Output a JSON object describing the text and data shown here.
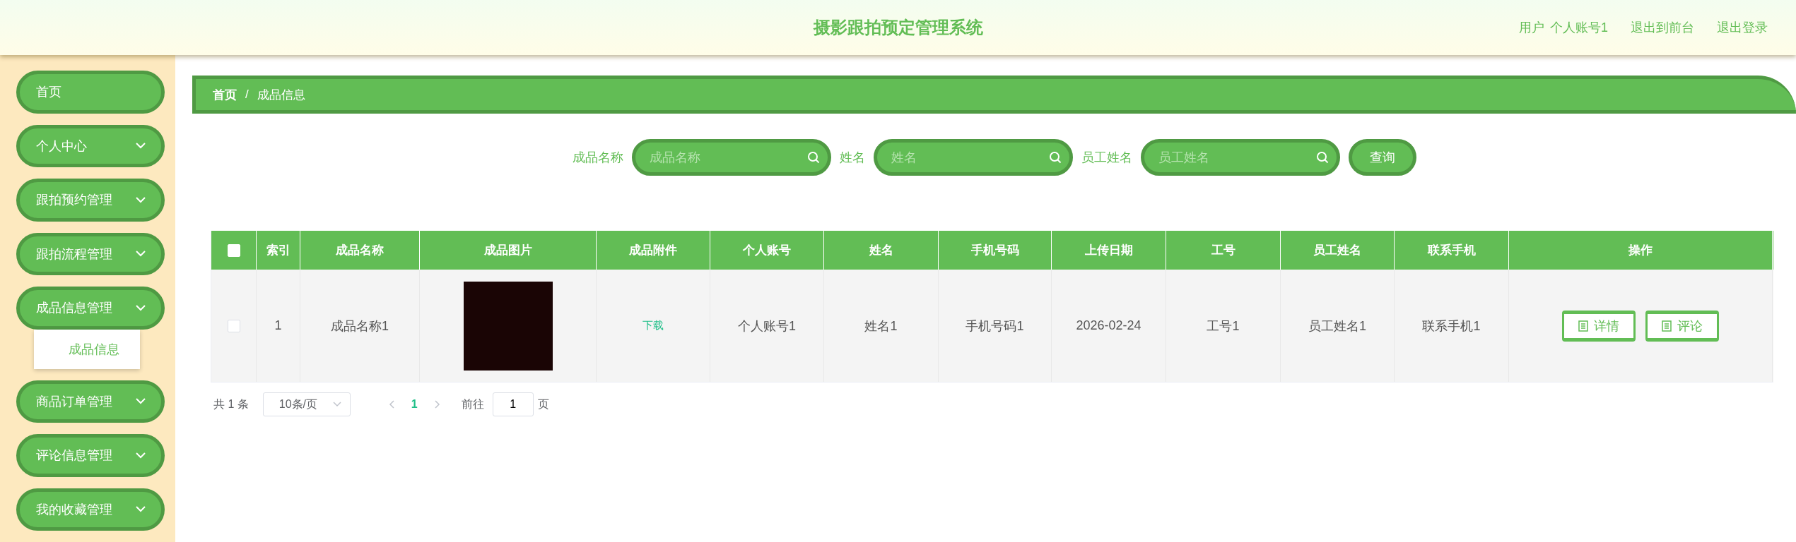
{
  "header": {
    "title": "摄影跟拍预定管理系统",
    "user_label": "用户",
    "user_name": "个人账号1",
    "links": [
      "退出到前台",
      "退出登录"
    ]
  },
  "sidebar": {
    "items": [
      {
        "kind": "link",
        "label": "首页"
      },
      {
        "kind": "group",
        "label": "个人中心"
      },
      {
        "kind": "group",
        "label": "跟拍预约管理"
      },
      {
        "kind": "group",
        "label": "跟拍流程管理"
      },
      {
        "kind": "group",
        "label": "成品信息管理",
        "children": [
          {
            "label": "成品信息",
            "selected": true
          }
        ]
      },
      {
        "kind": "group",
        "label": "商品订单管理"
      },
      {
        "kind": "group",
        "label": "评论信息管理"
      },
      {
        "kind": "group",
        "label": "我的收藏管理"
      }
    ]
  },
  "breadcrumb": {
    "items": [
      "首页",
      "成品信息"
    ],
    "separator": "/"
  },
  "search": {
    "fields": [
      {
        "label": "成品名称",
        "placeholder": "成品名称"
      },
      {
        "label": "姓名",
        "placeholder": "姓名"
      },
      {
        "label": "员工姓名",
        "placeholder": "员工姓名"
      }
    ],
    "button": "查询"
  },
  "table": {
    "header_checked": false,
    "columns": [
      "索引",
      "成品名称",
      "成品图片",
      "成品附件",
      "个人账号",
      "姓名",
      "手机号码",
      "上传日期",
      "工号",
      "员工姓名",
      "联系手机",
      "操作"
    ],
    "rows": [
      {
        "selected": false,
        "cells": [
          {
            "kind": "text",
            "text": "1"
          },
          {
            "kind": "text",
            "text": "成品名称1"
          },
          {
            "kind": "image"
          },
          {
            "kind": "link",
            "text": "下载"
          },
          {
            "kind": "text",
            "text": "个人账号1"
          },
          {
            "kind": "text",
            "text": "姓名1"
          },
          {
            "kind": "text",
            "text": "手机号码1"
          },
          {
            "kind": "text",
            "text": "2026-02-24"
          },
          {
            "kind": "text",
            "text": "工号1"
          },
          {
            "kind": "text",
            "text": "员工姓名1"
          },
          {
            "kind": "text",
            "text": "联系手机1"
          },
          {
            "kind": "actions",
            "buttons": [
              "详情",
              "评论"
            ]
          }
        ]
      }
    ]
  },
  "pagination": {
    "total": "共 1 条",
    "page_size": "10条/页",
    "pages": [
      {
        "label": "1",
        "selected": true
      }
    ],
    "goto_label": "前往",
    "goto_value": "1",
    "goto_suffix": "页"
  }
}
